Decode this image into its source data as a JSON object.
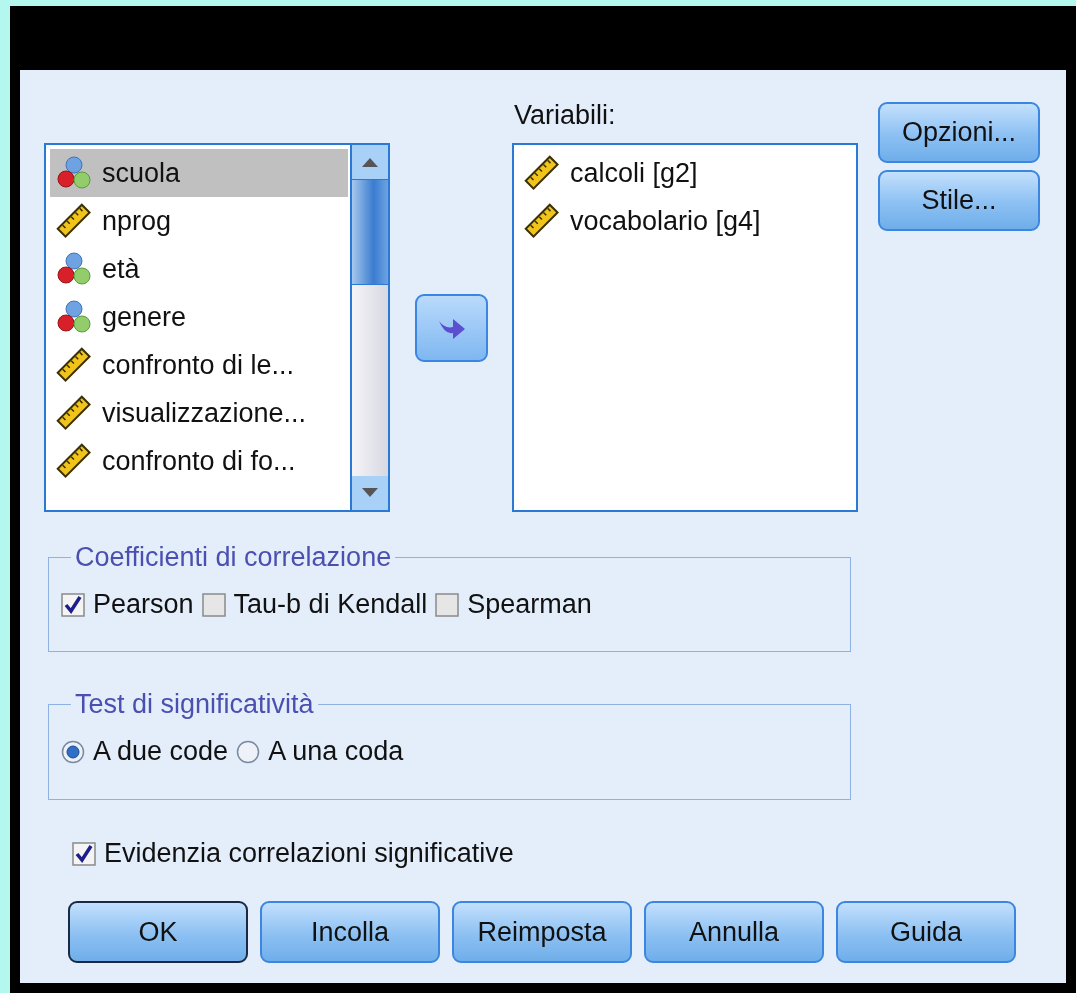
{
  "source_list": {
    "items": [
      {
        "label": "scuola",
        "kind": "nominal",
        "selected": true
      },
      {
        "label": "nprog",
        "kind": "scale",
        "selected": false
      },
      {
        "label": "età",
        "kind": "nominal",
        "selected": false
      },
      {
        "label": "genere",
        "kind": "nominal",
        "selected": false
      },
      {
        "label": "confronto di le...",
        "kind": "scale",
        "selected": false
      },
      {
        "label": "visualizzazione...",
        "kind": "scale",
        "selected": false
      },
      {
        "label": "confronto di fo...",
        "kind": "scale",
        "selected": false
      }
    ]
  },
  "target": {
    "label": "Variabili:",
    "items": [
      {
        "label": "calcoli [g2]",
        "kind": "scale"
      },
      {
        "label": "vocabolario [g4]",
        "kind": "scale"
      }
    ]
  },
  "side_buttons": [
    "Opzioni...",
    "Stile..."
  ],
  "coefficients": {
    "title": "Coefficienti di correlazione",
    "options": [
      {
        "label": "Pearson",
        "checked": true
      },
      {
        "label": "Tau-b di Kendall",
        "checked": false
      },
      {
        "label": "Spearman",
        "checked": false
      }
    ]
  },
  "significance": {
    "title": "Test di significatività",
    "options": [
      {
        "label": "A due code",
        "selected": true
      },
      {
        "label": "A una coda",
        "selected": false
      }
    ]
  },
  "flag": {
    "label": "Evidenzia correlazioni significative",
    "checked": true
  },
  "buttons": [
    {
      "label": "OK",
      "default": true
    },
    {
      "label": "Incolla",
      "default": false
    },
    {
      "label": "Reimposta",
      "default": false
    },
    {
      "label": "Annulla",
      "default": false
    },
    {
      "label": "Guida",
      "default": false
    }
  ]
}
